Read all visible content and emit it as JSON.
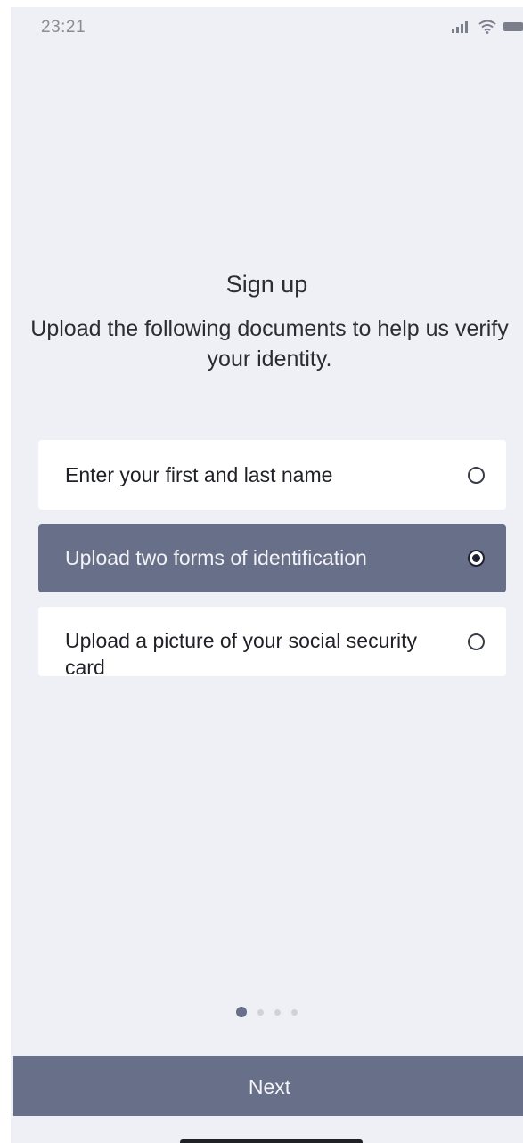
{
  "status_bar": {
    "time": "23:21",
    "icons": [
      "signal-icon",
      "wifi-icon",
      "battery-icon"
    ]
  },
  "header": {
    "title": "Sign up",
    "subtitle": "Upload the following documents to help us verify your identity."
  },
  "options": [
    {
      "label": "Enter your first and last name",
      "selected": false
    },
    {
      "label": "Upload two forms of identification",
      "selected": true
    },
    {
      "label": "Upload a picture of your social security card",
      "selected": false
    }
  ],
  "pager": {
    "total": 4,
    "current": 1
  },
  "footer": {
    "next_label": "Next"
  },
  "colors": {
    "accent": "#686f88",
    "background": "#eef0f6",
    "card": "#ffffff",
    "text": "#1f2126"
  }
}
